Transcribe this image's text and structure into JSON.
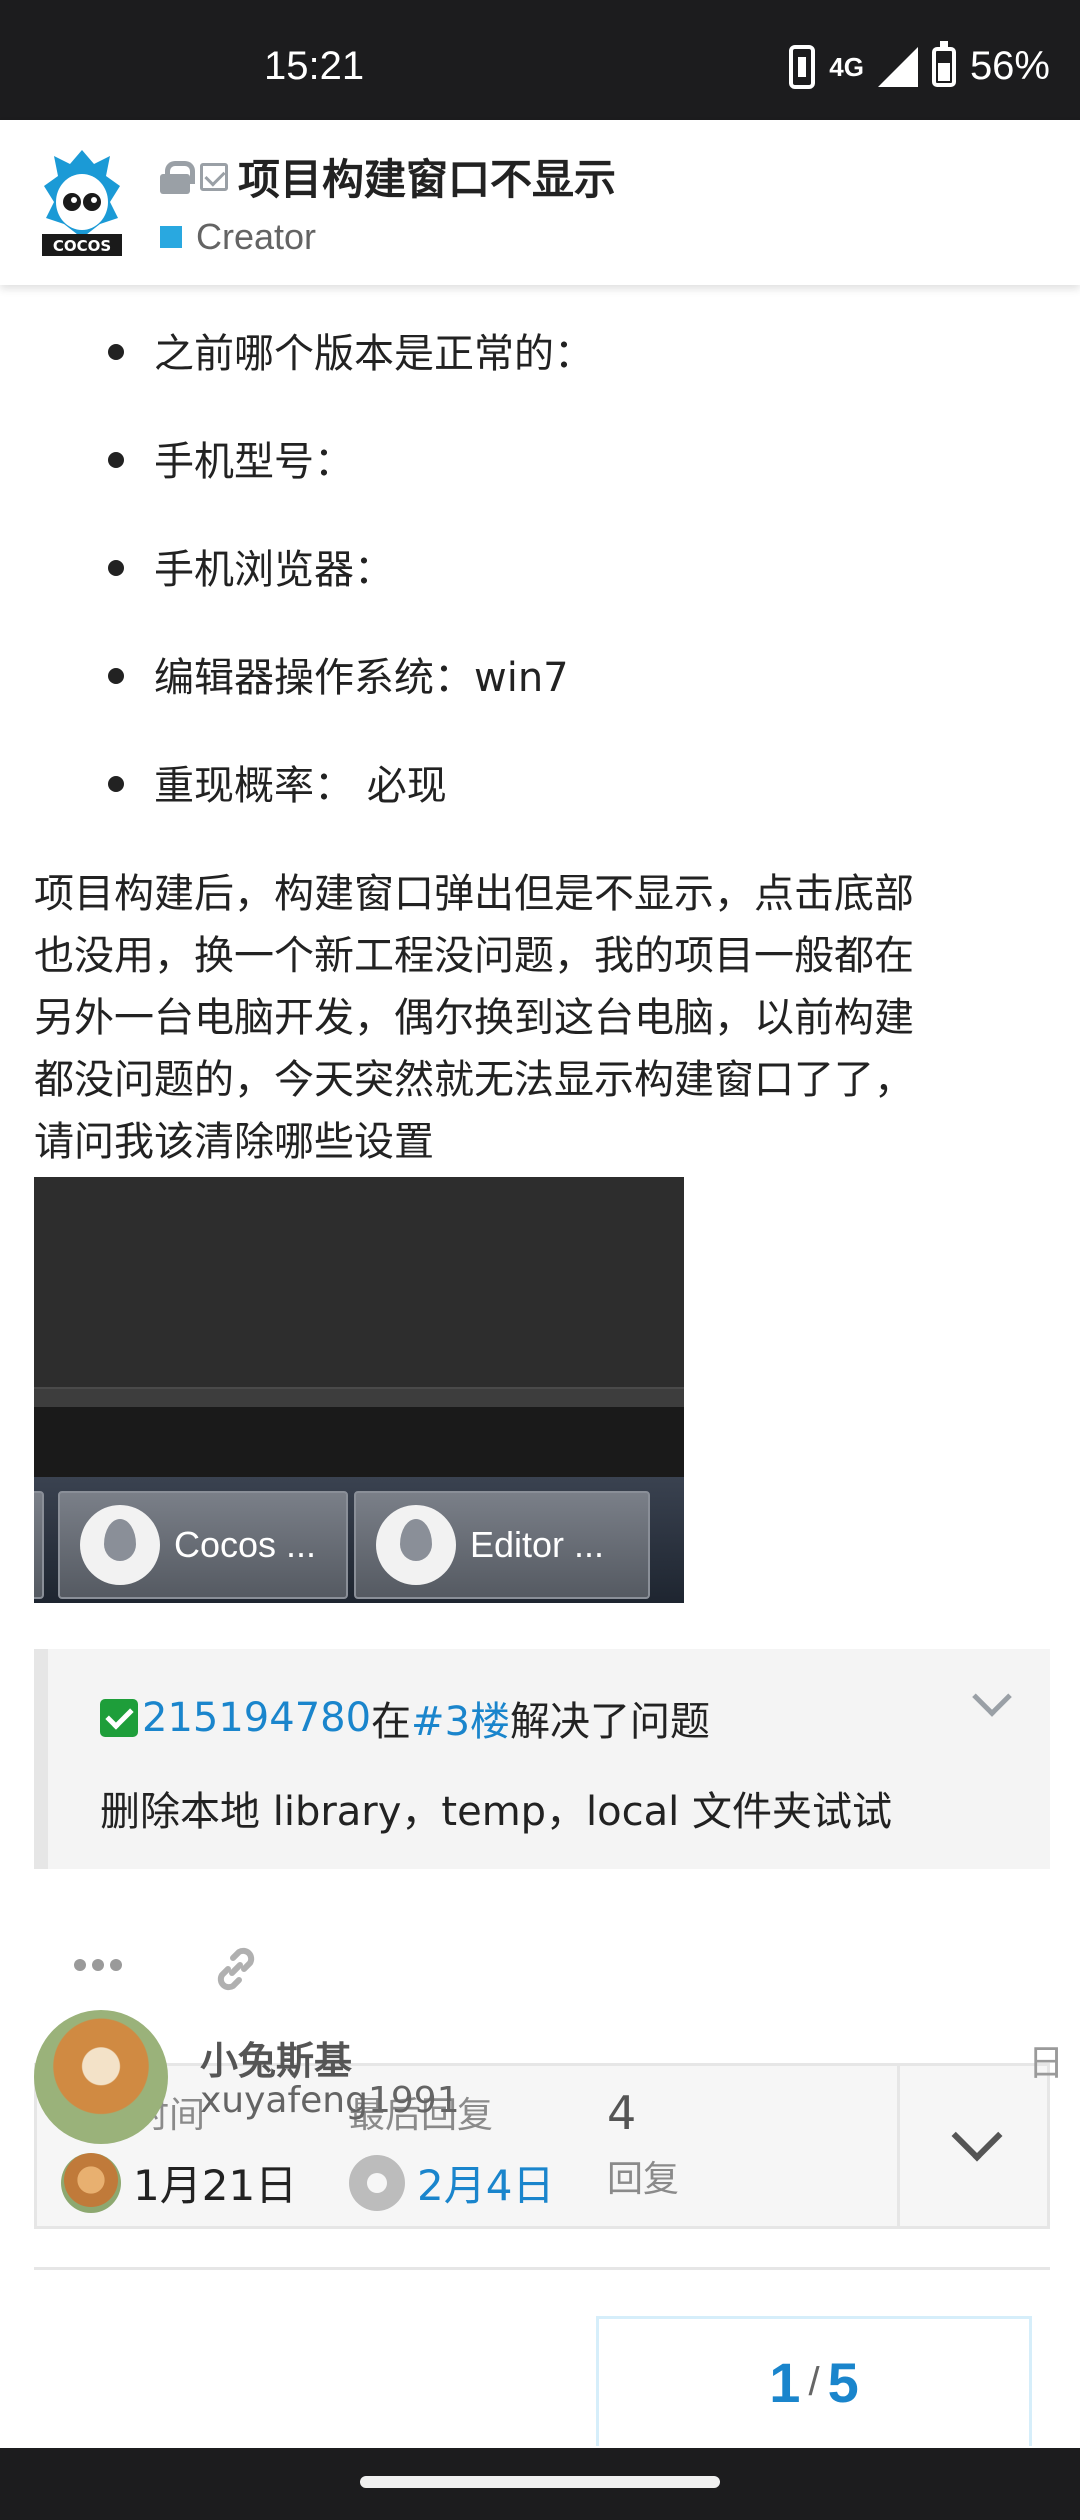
{
  "status_bar": {
    "time": "15:21",
    "network": "4G",
    "battery": "56%"
  },
  "header": {
    "title": "项目构建窗口不显示",
    "category": "Creator",
    "category_color": "#29a8e0",
    "logo_text": "COCOS"
  },
  "bullets": [
    {
      "label": "之前哪个版本是正常的："
    },
    {
      "label": "手机型号："
    },
    {
      "label": "手机浏览器："
    },
    {
      "label": "编辑器操作系统：win7"
    },
    {
      "label": "重现概率： 必现"
    }
  ],
  "body_lines": [
    "项目构建后，构建窗口弹出但是不显示，点击底部",
    "也没用，换一个新工程没问题，我的项目一般都在",
    "另外一台电脑开发，偶尔换到这台电脑，以前构建",
    "都没问题的，今天突然就无法显示构建窗口了了，",
    "请问我该清除哪些设置"
  ],
  "screenshot": {
    "button_1": "Cocos ...",
    "button_2": "Editor ..."
  },
  "solution": {
    "user": "215194780",
    "connector": "在",
    "post_ref": "#3楼",
    "suffix": "解决了问题",
    "body": "删除本地 library，temp，local 文件夹试试"
  },
  "topic_map": {
    "created_label": "创建时间",
    "created_date": "1月21日",
    "last_reply_label": "最后回复",
    "last_reply_date": "2月4日",
    "replies_count": "4",
    "replies_label": "回复"
  },
  "post": {
    "username": "小兔斯基",
    "handle": "xuyafeng1991",
    "meta_cut": "日"
  },
  "progress": {
    "current": "1",
    "separator": "/",
    "total": "5"
  },
  "colors": {
    "link": "#1a85cc",
    "solved": "#1e9e3a"
  }
}
